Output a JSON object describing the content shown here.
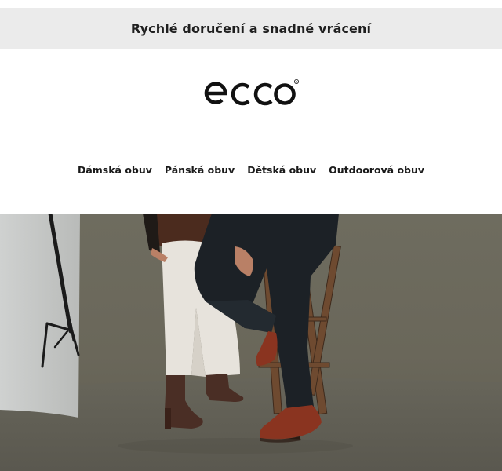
{
  "promo": {
    "text": "Rychlé doručení a snadné vrácení"
  },
  "header": {
    "logo_icon": "ecco-logo"
  },
  "nav": {
    "items": [
      {
        "label": "Dámská obuv"
      },
      {
        "label": "Pánská obuv"
      },
      {
        "label": "Dětská obuv"
      },
      {
        "label": "Outdoorová obuv"
      }
    ]
  },
  "hero": {
    "image": "photo-two-models-shoes-stool"
  },
  "colors": {
    "promo_bg": "#ebebeb",
    "hero_backdrop": "#6f6d60",
    "boot_brown": "#4a2e25",
    "shoe_cognac": "#8a3420"
  }
}
